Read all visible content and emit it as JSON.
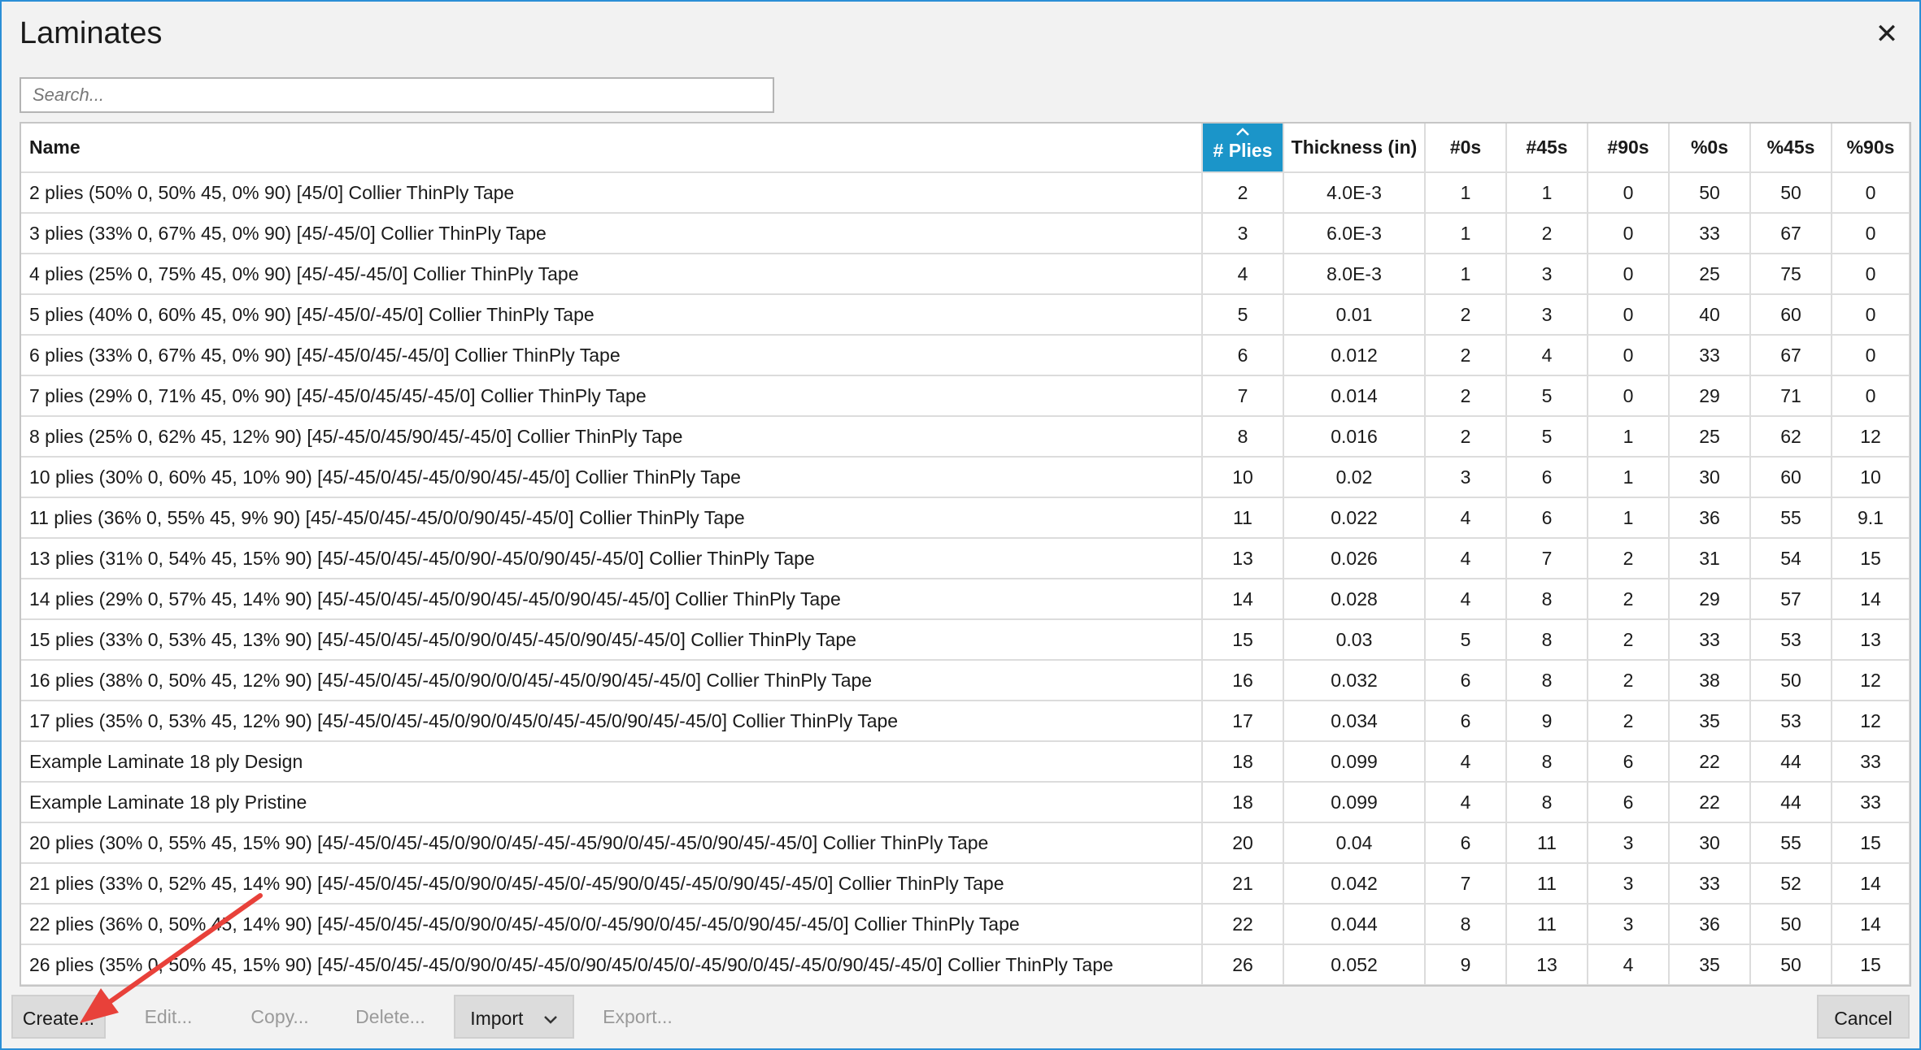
{
  "window": {
    "title": "Laminates",
    "close_glyph": "✕"
  },
  "search": {
    "placeholder": "Search...",
    "value": ""
  },
  "table": {
    "columns": [
      "Name",
      "# Plies",
      "Thickness (in)",
      "#0s",
      "#45s",
      "#90s",
      "%0s",
      "%45s",
      "%90s"
    ],
    "sorted_column": "# Plies",
    "sort_direction": "ascending",
    "sort_color": "#1b95c9",
    "rows": [
      [
        "2 plies (50% 0, 50% 45, 0% 90) [45/0] Collier ThinPly Tape",
        "2",
        "4.0E-3",
        "1",
        "1",
        "0",
        "50",
        "50",
        "0"
      ],
      [
        "3 plies (33% 0, 67% 45, 0% 90) [45/-45/0] Collier ThinPly Tape",
        "3",
        "6.0E-3",
        "1",
        "2",
        "0",
        "33",
        "67",
        "0"
      ],
      [
        "4 plies (25% 0, 75% 45, 0% 90) [45/-45/-45/0] Collier ThinPly Tape",
        "4",
        "8.0E-3",
        "1",
        "3",
        "0",
        "25",
        "75",
        "0"
      ],
      [
        "5 plies (40% 0, 60% 45, 0% 90) [45/-45/0/-45/0] Collier ThinPly Tape",
        "5",
        "0.01",
        "2",
        "3",
        "0",
        "40",
        "60",
        "0"
      ],
      [
        "6 plies (33% 0, 67% 45, 0% 90) [45/-45/0/45/-45/0] Collier ThinPly Tape",
        "6",
        "0.012",
        "2",
        "4",
        "0",
        "33",
        "67",
        "0"
      ],
      [
        "7 plies (29% 0, 71% 45, 0% 90) [45/-45/0/45/45/-45/0] Collier ThinPly Tape",
        "7",
        "0.014",
        "2",
        "5",
        "0",
        "29",
        "71",
        "0"
      ],
      [
        "8 plies (25% 0, 62% 45, 12% 90) [45/-45/0/45/90/45/-45/0] Collier ThinPly Tape",
        "8",
        "0.016",
        "2",
        "5",
        "1",
        "25",
        "62",
        "12"
      ],
      [
        "10 plies (30% 0, 60% 45, 10% 90) [45/-45/0/45/-45/0/90/45/-45/0] Collier ThinPly Tape",
        "10",
        "0.02",
        "3",
        "6",
        "1",
        "30",
        "60",
        "10"
      ],
      [
        "11 plies (36% 0, 55% 45, 9% 90) [45/-45/0/45/-45/0/0/90/45/-45/0] Collier ThinPly Tape",
        "11",
        "0.022",
        "4",
        "6",
        "1",
        "36",
        "55",
        "9.1"
      ],
      [
        "13 plies (31% 0, 54% 45, 15% 90) [45/-45/0/45/-45/0/90/-45/0/90/45/-45/0] Collier ThinPly Tape",
        "13",
        "0.026",
        "4",
        "7",
        "2",
        "31",
        "54",
        "15"
      ],
      [
        "14 plies (29% 0, 57% 45, 14% 90) [45/-45/0/45/-45/0/90/45/-45/0/90/45/-45/0] Collier ThinPly Tape",
        "14",
        "0.028",
        "4",
        "8",
        "2",
        "29",
        "57",
        "14"
      ],
      [
        "15 plies (33% 0, 53% 45, 13% 90) [45/-45/0/45/-45/0/90/0/45/-45/0/90/45/-45/0] Collier ThinPly Tape",
        "15",
        "0.03",
        "5",
        "8",
        "2",
        "33",
        "53",
        "13"
      ],
      [
        "16 plies (38% 0, 50% 45, 12% 90) [45/-45/0/45/-45/0/90/0/0/45/-45/0/90/45/-45/0] Collier ThinPly Tape",
        "16",
        "0.032",
        "6",
        "8",
        "2",
        "38",
        "50",
        "12"
      ],
      [
        "17 plies (35% 0, 53% 45, 12% 90) [45/-45/0/45/-45/0/90/0/45/0/45/-45/0/90/45/-45/0] Collier ThinPly Tape",
        "17",
        "0.034",
        "6",
        "9",
        "2",
        "35",
        "53",
        "12"
      ],
      [
        "Example Laminate 18 ply Design",
        "18",
        "0.099",
        "4",
        "8",
        "6",
        "22",
        "44",
        "33"
      ],
      [
        "Example Laminate 18 ply Pristine",
        "18",
        "0.099",
        "4",
        "8",
        "6",
        "22",
        "44",
        "33"
      ],
      [
        "20 plies (30% 0, 55% 45, 15% 90) [45/-45/0/45/-45/0/90/0/45/-45/-45/90/0/45/-45/0/90/45/-45/0] Collier ThinPly Tape",
        "20",
        "0.04",
        "6",
        "11",
        "3",
        "30",
        "55",
        "15"
      ],
      [
        "21 plies (33% 0, 52% 45, 14% 90) [45/-45/0/45/-45/0/90/0/45/-45/0/-45/90/0/45/-45/0/90/45/-45/0] Collier ThinPly Tape",
        "21",
        "0.042",
        "7",
        "11",
        "3",
        "33",
        "52",
        "14"
      ],
      [
        "22 plies (36% 0, 50% 45, 14% 90) [45/-45/0/45/-45/0/90/0/45/-45/0/0/-45/90/0/45/-45/0/90/45/-45/0] Collier ThinPly Tape",
        "22",
        "0.044",
        "8",
        "11",
        "3",
        "36",
        "50",
        "14"
      ],
      [
        "26 plies (35% 0, 50% 45, 15% 90) [45/-45/0/45/-45/0/90/0/45/-45/0/90/45/0/45/0/-45/90/0/45/-45/0/90/45/-45/0] Collier ThinPly Tape",
        "26",
        "0.052",
        "9",
        "13",
        "4",
        "35",
        "50",
        "15"
      ]
    ]
  },
  "footer": {
    "create": "Create...",
    "edit": "Edit...",
    "copy": "Copy...",
    "delete": "Delete...",
    "import": "Import",
    "export": "Export...",
    "cancel": "Cancel"
  },
  "annotation": {
    "arrow_color": "#e8413a",
    "icon": "red-arrow-pointing-to-create"
  }
}
